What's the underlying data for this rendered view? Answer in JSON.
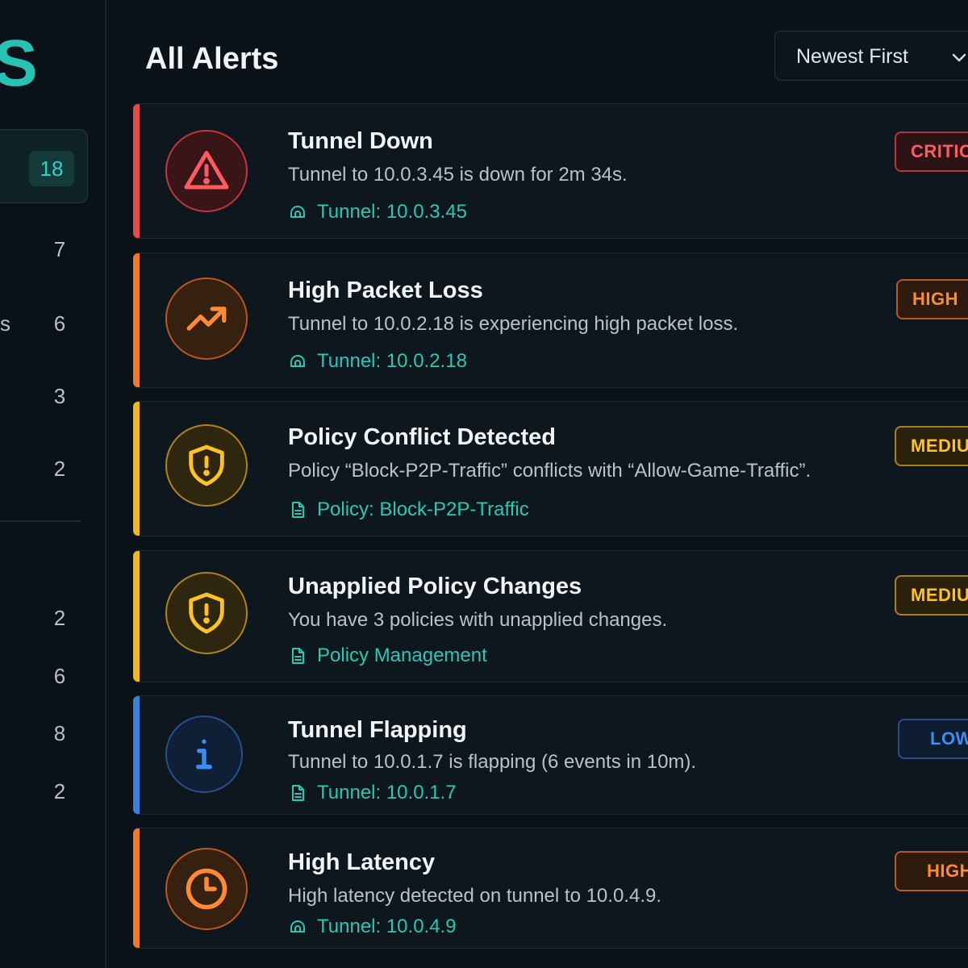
{
  "sidebar": {
    "brand_fragment": "S",
    "active_count": "18",
    "label_fragment": "s",
    "counts": [
      "7",
      "6",
      "3",
      "2",
      "2",
      "6",
      "8",
      "2"
    ]
  },
  "header": {
    "title": "All Alerts",
    "sort": {
      "selected": "Newest First",
      "icon": "chevron-down-icon"
    }
  },
  "alerts": [
    {
      "title": "Tunnel Down",
      "description": "Tunnel to 10.0.3.45 is down for 2m 34s.",
      "link": "Tunnel: 10.0.3.45",
      "link_icon": "tunnel-icon",
      "icon": "warning-triangle-icon",
      "severity": "CRITIC",
      "color": "#e5484d"
    },
    {
      "title": "High Packet Loss",
      "description": "Tunnel to 10.0.2.18 is experiencing high packet loss.",
      "link": "Tunnel: 10.0.2.18",
      "link_icon": "tunnel-icon",
      "icon": "trending-up-icon",
      "severity": "HIGH",
      "color": "#f07a2a"
    },
    {
      "title": "Policy Conflict Detected",
      "description": "Policy “Block-P2P-Traffic” conflicts with “Allow-Game-Traffic”.",
      "link": "Policy: Block-P2P-Traffic",
      "link_icon": "document-icon",
      "icon": "shield-alert-icon",
      "severity": "MEDIU",
      "color": "#f2b61f"
    },
    {
      "title": "Unapplied Policy Changes",
      "description": "You have 3 policies with unapplied changes.",
      "link": "Policy Management",
      "link_icon": "document-icon",
      "icon": "shield-alert-icon",
      "severity": "MEDIU",
      "color": "#f2b61f"
    },
    {
      "title": "Tunnel Flapping",
      "description": "Tunnel to 10.0.1.7 is flapping (6 events in 10m).",
      "link": "Tunnel: 10.0.1.7",
      "link_icon": "document-icon",
      "icon": "info-icon",
      "severity": "LOW",
      "color": "#3b82e0"
    },
    {
      "title": "High Latency",
      "description": "High latency detected on tunnel to 10.0.4.9.",
      "link": "Tunnel: 10.0.4.9",
      "link_icon": "tunnel-icon",
      "icon": "clock-icon",
      "severity": "HIGH",
      "color": "#f07a2a"
    }
  ]
}
